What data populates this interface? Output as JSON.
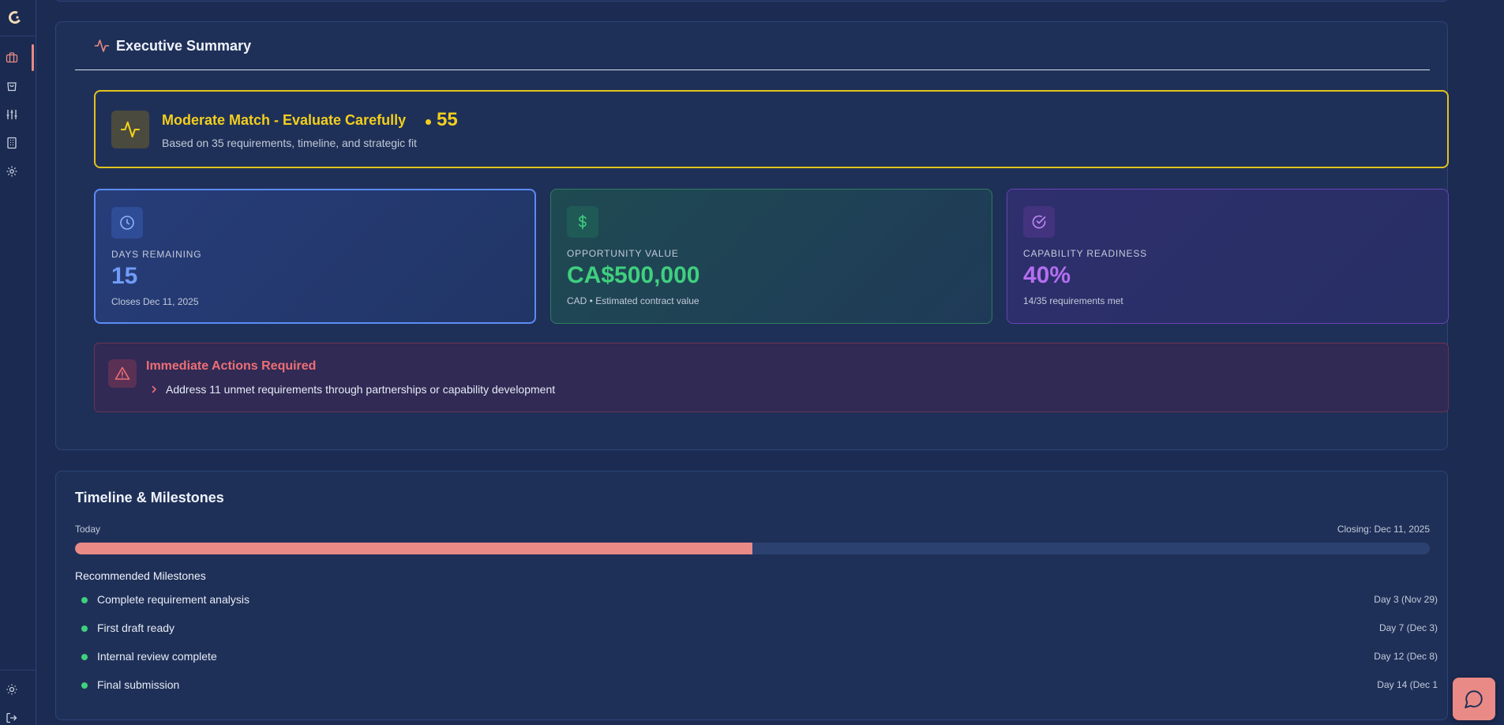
{
  "colors": {
    "accent": "#ea8a86",
    "warning": "#f2cf1d",
    "blue": "#6f9cf7",
    "green": "#3fd07e",
    "purple": "#b46ef0",
    "danger": "#ee6f74"
  },
  "sidebar": {
    "logo_icon": "c-logo-icon",
    "items": [
      {
        "icon": "briefcase-icon",
        "active": true
      },
      {
        "icon": "shopping-bag-icon",
        "active": false
      },
      {
        "icon": "sliders-icon",
        "active": false
      },
      {
        "icon": "building-icon",
        "active": false
      },
      {
        "icon": "gear-icon",
        "active": false
      }
    ],
    "bottom": [
      {
        "icon": "sun-icon"
      },
      {
        "icon": "logout-icon"
      }
    ]
  },
  "exec_summary": {
    "title": "Executive Summary",
    "icon": "activity-icon",
    "match": {
      "title": "Moderate Match - Evaluate Carefully",
      "score": "55",
      "subtitle": "Based on 35 requirements, timeline, and strategic fit",
      "icon": "activity-icon"
    },
    "stats": [
      {
        "label": "DAYS REMAINING",
        "value": "15",
        "sub": "Closes Dec 11, 2025",
        "icon": "clock-icon"
      },
      {
        "label": "OPPORTUNITY VALUE",
        "value": "CA$500,000",
        "sub": "CAD • Estimated contract value",
        "icon": "dollar-icon"
      },
      {
        "label": "CAPABILITY READINESS",
        "value": "40%",
        "sub": "14/35 requirements met",
        "icon": "check-circle-icon"
      }
    ],
    "actions": {
      "title": "Immediate Actions Required",
      "icon": "warning-icon",
      "items": [
        "Address 11 unmet requirements through partnerships or capability development"
      ]
    }
  },
  "timeline": {
    "title": "Timeline & Milestones",
    "start_label": "Today",
    "end_label": "Closing: Dec 11, 2025",
    "progress_fraction": 0.5,
    "milestones_title": "Recommended Milestones",
    "milestones": [
      {
        "label": "Complete requirement analysis",
        "date": "Day 3 (Nov 29)"
      },
      {
        "label": "First draft ready",
        "date": "Day 7 (Dec 3)"
      },
      {
        "label": "Internal review complete",
        "date": "Day 12 (Dec 8)"
      },
      {
        "label": "Final submission",
        "date": "Day 14 (Dec 1"
      }
    ]
  },
  "chat": {
    "icon": "chat-icon"
  }
}
